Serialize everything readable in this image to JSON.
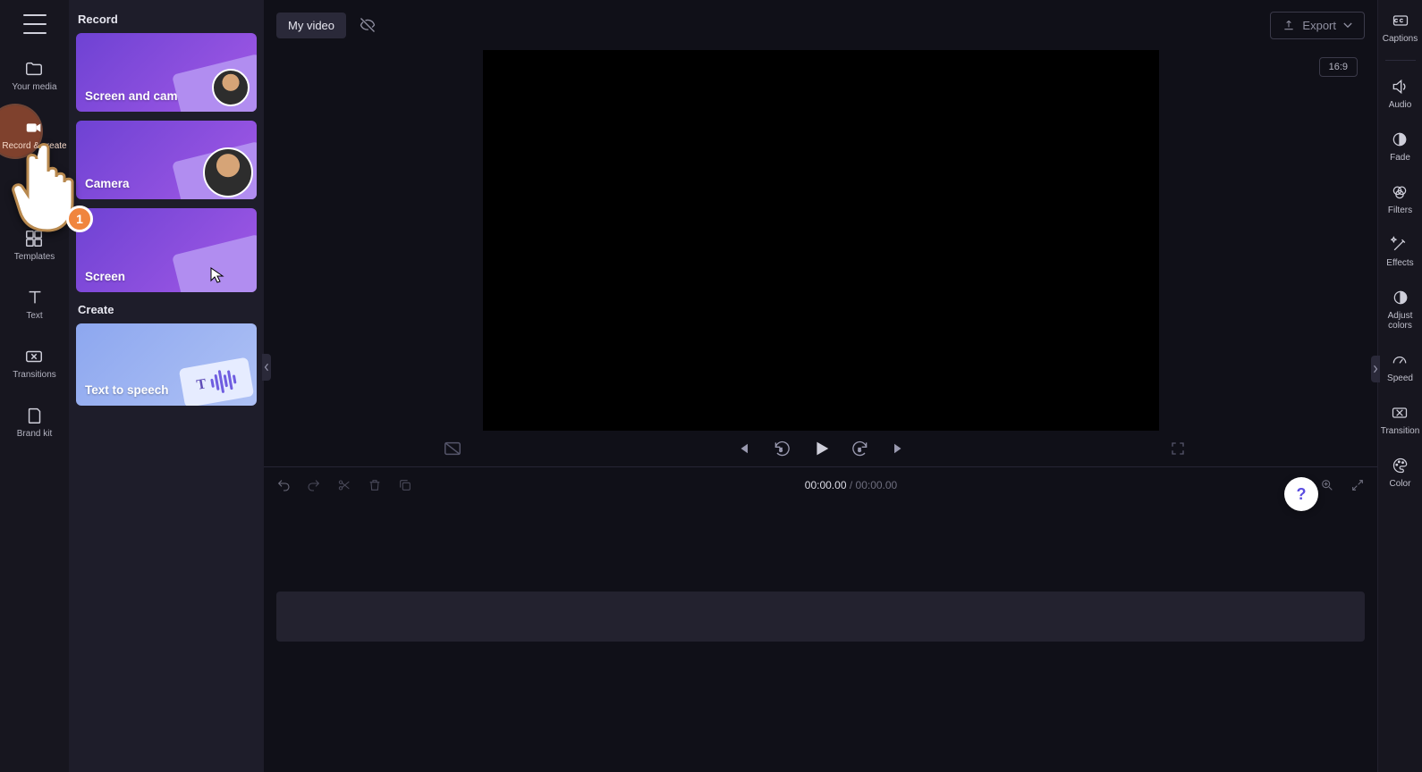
{
  "leftRail": {
    "items": [
      {
        "key": "your-media",
        "label": "Your media"
      },
      {
        "key": "record-create",
        "label": "Record & create"
      },
      {
        "key": "templates",
        "label": "Templates"
      },
      {
        "key": "text",
        "label": "Text"
      },
      {
        "key": "transitions",
        "label": "Transitions"
      },
      {
        "key": "brand-kit",
        "label": "Brand kit"
      }
    ]
  },
  "panel": {
    "sectionRecord": "Record",
    "sectionCreate": "Create",
    "cards": {
      "screenCamera": "Screen and camera",
      "camera": "Camera",
      "screen": "Screen",
      "tts": "Text to speech"
    }
  },
  "topbar": {
    "title": "My video",
    "export": "Export"
  },
  "stage": {
    "aspect": "16:9"
  },
  "timeline": {
    "current": "00:00.00",
    "separator": " / ",
    "total": "00:00.00"
  },
  "rightRail": {
    "items": [
      {
        "key": "captions",
        "label": "Captions"
      },
      {
        "key": "audio",
        "label": "Audio"
      },
      {
        "key": "fade",
        "label": "Fade"
      },
      {
        "key": "filters",
        "label": "Filters"
      },
      {
        "key": "effects",
        "label": "Effects"
      },
      {
        "key": "adjust-colors",
        "label": "Adjust colors"
      },
      {
        "key": "speed",
        "label": "Speed"
      },
      {
        "key": "transition",
        "label": "Transition"
      },
      {
        "key": "color",
        "label": "Color"
      }
    ]
  },
  "annotation": {
    "badge": "1"
  },
  "help": {
    "glyph": "?"
  }
}
